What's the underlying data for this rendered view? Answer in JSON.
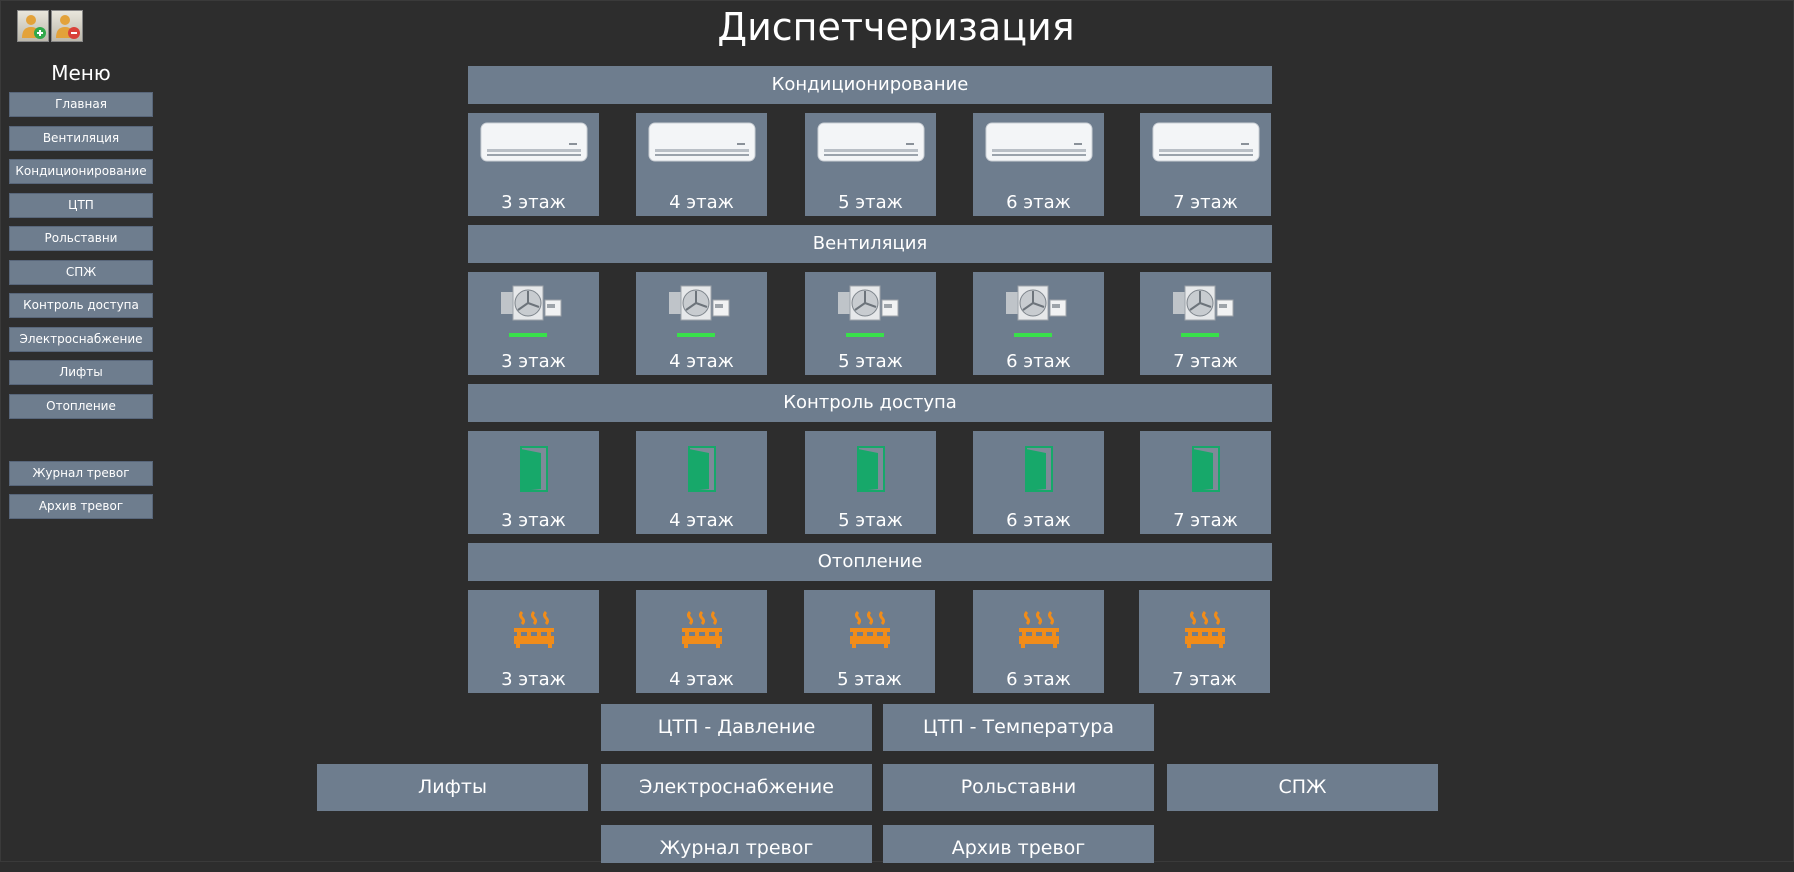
{
  "header": {
    "title": "Диспетчеризация"
  },
  "toolbar": {
    "add_user_icon": "user-add-icon",
    "remove_user_icon": "user-remove-icon"
  },
  "menu": {
    "title": "Меню",
    "items": [
      {
        "label": "Главная"
      },
      {
        "label": "Вентиляция"
      },
      {
        "label": "Кондиционирование"
      },
      {
        "label": "ЦТП"
      },
      {
        "label": "Рольставни"
      },
      {
        "label": "СПЖ"
      },
      {
        "label": "Контроль доступа"
      },
      {
        "label": "Электроснабжение"
      },
      {
        "label": "Лифты"
      },
      {
        "label": "Отопление"
      }
    ],
    "alarm_items": [
      {
        "label": "Журнал тревог"
      },
      {
        "label": "Архив тревог"
      }
    ]
  },
  "sections": [
    {
      "title": "Кондиционирование",
      "icon": "air-conditioner-icon",
      "floors": [
        "3 этаж",
        "4 этаж",
        "5 этаж",
        "6 этаж",
        "7 этаж"
      ]
    },
    {
      "title": "Вентиляция",
      "icon": "ventilation-fan-icon",
      "status_color": "#39e04a",
      "floors": [
        "3 этаж",
        "4 этаж",
        "5 этаж",
        "6 этаж",
        "7 этаж"
      ]
    },
    {
      "title": "Контроль доступа",
      "icon": "door-icon",
      "door_color": "#17a86a",
      "floors": [
        "3 этаж",
        "4 этаж",
        "5 этаж",
        "6 этаж",
        "7 этаж"
      ]
    },
    {
      "title": "Отопление",
      "icon": "heater-icon",
      "heater_color": "#f08c1a",
      "floors": [
        "3 этаж",
        "4 этаж",
        "5 этаж",
        "6 этаж",
        "7 этаж"
      ]
    }
  ],
  "bottom_buttons": {
    "ctp_pressure": "ЦТП - Давление",
    "ctp_temperature": "ЦТП - Температура",
    "lifts": "Лифты",
    "power": "Электроснабжение",
    "shutters": "Рольставни",
    "spzh": "СПЖ",
    "alarm_journal": "Журнал тревог",
    "alarm_archive": "Архив тревог"
  },
  "colors": {
    "background": "#2d2d2d",
    "panel": "#6e7d8e"
  }
}
